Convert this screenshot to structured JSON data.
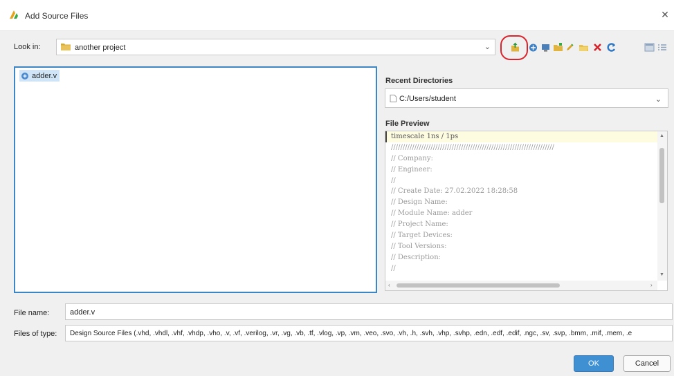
{
  "dialog": {
    "title": "Add Source Files"
  },
  "look_in": {
    "label": "Look in:",
    "value": "another project"
  },
  "toolbar": {
    "icons": [
      "folder-up-icon",
      "location-icon",
      "desktop-icon",
      "new-folder-icon",
      "edit-icon",
      "open-folder-icon",
      "delete-icon",
      "refresh-icon",
      "list-view-icon",
      "details-view-icon"
    ]
  },
  "file_list": {
    "items": [
      {
        "name": "adder.v"
      }
    ]
  },
  "recent": {
    "heading": "Recent Directories",
    "value": "C:/Users/student"
  },
  "preview": {
    "heading": "File Preview",
    "lines": [
      "timescale 1ns / 1ps",
      "//////////////////////////////////////////////////////////////////////",
      "// Company:",
      "// Engineer:",
      "//",
      "// Create Date: 27.02.2022 18:28:58",
      "// Design Name:",
      "// Module Name: adder",
      "// Project Name:",
      "// Target Devices:",
      "// Tool Versions:",
      "// Description:",
      "//"
    ]
  },
  "file_name": {
    "label": "File name:",
    "value": "adder.v"
  },
  "files_of_type": {
    "label": "Files of type:",
    "value": "Design Source Files (.vhd, .vhdl, .vhf, .vhdp, .vho, .v, .vf, .verilog, .vr, .vg, .vb, .tf, .vlog, .vp, .vm, .veo, .svo, .vh, .h, .svh, .vhp, .svhp, .edn, .edf, .edif, .ngc, .sv, .svp, .bmm, .mif, .mem, .e"
  },
  "buttons": {
    "ok": "OK",
    "cancel": "Cancel"
  },
  "colors": {
    "accent": "#3f8fd3",
    "selection": "#cfe4f7",
    "highlight_ring": "#d9232d"
  }
}
